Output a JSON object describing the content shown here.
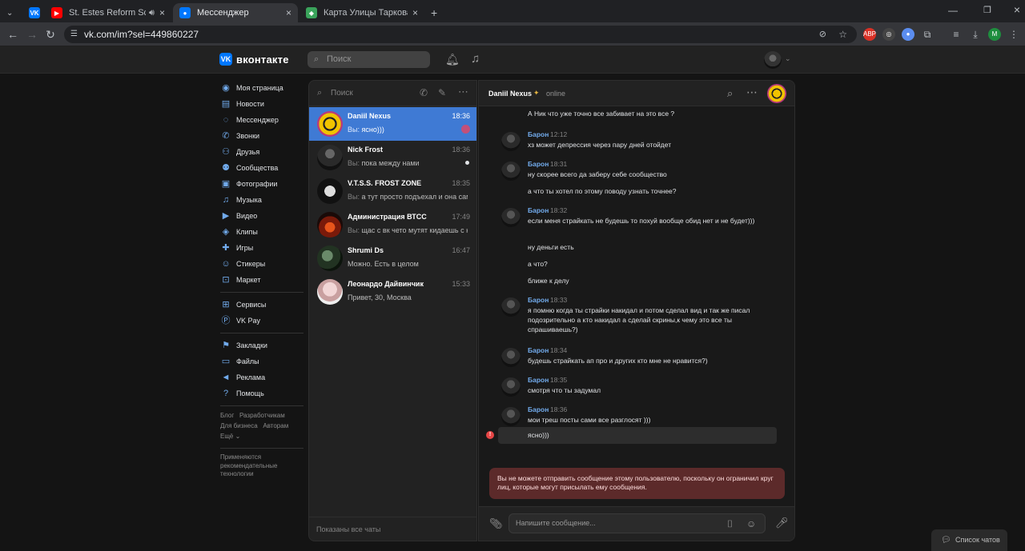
{
  "browser": {
    "tabs": [
      {
        "title": "",
        "fav": "VK",
        "fav_color": "#0077ff",
        "has_close": false
      },
      {
        "title": "St. Estes Reform School (Ext",
        "fav": "▶",
        "fav_color": "#ff0000",
        "has_close": true
      },
      {
        "title": "Мессенджер",
        "fav": "●",
        "fav_color": "#0077ff",
        "has_close": true
      },
      {
        "title": "Карта Улицы Таркова | Escape",
        "fav": "◆",
        "fav_color": "#3aa35b",
        "has_close": true
      }
    ],
    "url": "vk.com/im?sel=449860227"
  },
  "header": {
    "logo_text": "вконтакте",
    "search_placeholder": "Поиск"
  },
  "sidebar": {
    "items": [
      {
        "label": "Моя страница",
        "icon": "user-icon"
      },
      {
        "label": "Новости",
        "icon": "news-icon"
      },
      {
        "label": "Мессенджер",
        "icon": "chat-icon"
      },
      {
        "label": "Звонки",
        "icon": "phone-icon"
      },
      {
        "label": "Друзья",
        "icon": "friends-icon"
      },
      {
        "label": "Сообщества",
        "icon": "communities-icon"
      },
      {
        "label": "Фотографии",
        "icon": "photo-icon"
      },
      {
        "label": "Музыка",
        "icon": "music-icon"
      },
      {
        "label": "Видео",
        "icon": "video-icon"
      },
      {
        "label": "Клипы",
        "icon": "clips-icon"
      },
      {
        "label": "Игры",
        "icon": "games-icon"
      },
      {
        "label": "Стикеры",
        "icon": "stickers-icon"
      },
      {
        "label": "Маркет",
        "icon": "market-icon"
      }
    ],
    "items2": [
      {
        "label": "Сервисы",
        "icon": "services-icon"
      },
      {
        "label": "VK Pay",
        "icon": "vkpay-icon"
      }
    ],
    "items3": [
      {
        "label": "Закладки",
        "icon": "bookmark-icon"
      },
      {
        "label": "Файлы",
        "icon": "files-icon"
      },
      {
        "label": "Реклама",
        "icon": "ads-icon"
      },
      {
        "label": "Помощь",
        "icon": "help-icon"
      }
    ],
    "footer_links": [
      "Блог",
      "Разработчикам",
      "Для бизнеса",
      "Авторам",
      "Ещё ⌄"
    ],
    "note": "Применяются рекомендательные технологии"
  },
  "conversations": {
    "search_placeholder": "Поиск",
    "items": [
      {
        "name": "Daniil Nexus",
        "time": "18:36",
        "me": "Вы:",
        "preview": "ясно)))",
        "selected": true
      },
      {
        "name": "Nick Frost",
        "time": "18:36",
        "me": "Вы:",
        "preview": "пока между нами",
        "selected": false
      },
      {
        "name": "V.T.S.S. FROST ZONE",
        "time": "18:35",
        "me": "Вы:",
        "preview": "а тут просто подъехал и она сама",
        "selected": false
      },
      {
        "name": "Администрация ВТСС",
        "time": "17:49",
        "me": "Вы:",
        "preview": "щас с вк чето мутят кидаешь с ю...",
        "selected": false
      },
      {
        "name": "Shrumi Ds",
        "time": "16:47",
        "me": "",
        "preview": "Можно. Есть в целом",
        "selected": false
      },
      {
        "name": "Леонардо Дайвинчик",
        "time": "15:33",
        "me": "",
        "preview": "Привет, 30, Москва",
        "selected": false
      }
    ],
    "footer": "Показаны все чаты"
  },
  "chat": {
    "name": "Daniil Nexus",
    "status": "online",
    "first_line": "А Ник что уже точно все забивает на это все ?",
    "messages": [
      {
        "author": "Барон",
        "time": "12:12",
        "lines": [
          "хз может депрессия через пару дней отойдет"
        ]
      },
      {
        "author": "Барон",
        "time": "18:31",
        "lines": [
          "ну скорее всего да заберу себе сообщество",
          "а что ты хотел по этому поводу узнать точнее?"
        ]
      },
      {
        "author": "Барон",
        "time": "18:32",
        "lines": [
          "если меня страйкать не будешь то похуй вообще обид нет и не будет)))",
          "ну деньги есть",
          "а что?",
          "ближе к делу"
        ]
      },
      {
        "author": "Барон",
        "time": "18:33",
        "lines": [
          "я помню когда ты страйки накидал и потом сделал вид и так же писал подозрительно а кто накидал а сделай скрины,к чему это все ты спрашиваешь?)"
        ]
      },
      {
        "author": "Барон",
        "time": "18:34",
        "lines": [
          "будешь страйкать ап про и других кто мне не нравится?)"
        ]
      },
      {
        "author": "Барон",
        "time": "18:35",
        "lines": [
          "смотря что ты задумал"
        ]
      },
      {
        "author": "Барон",
        "time": "18:36",
        "lines": [
          "мои треш посты сами все разглосят )))"
        ]
      }
    ],
    "my_message": "ясно)))",
    "warning": "Вы не можете отправить сообщение этому пользователю, поскольку он ограничил круг лиц, которые могут присылать ему сообщения.",
    "compose_placeholder": "Напишите сообщение..."
  },
  "chat_list_button": "Список чатов"
}
